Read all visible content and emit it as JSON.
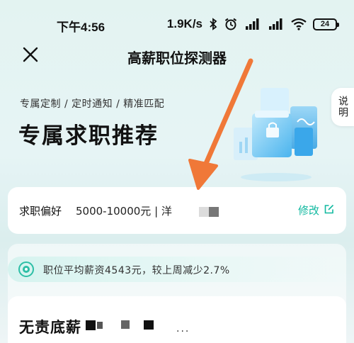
{
  "status_bar": {
    "time": "下午4:56",
    "net_speed": "1.9K/s",
    "battery": "24"
  },
  "nav": {
    "title": "高薪职位探测器"
  },
  "hero": {
    "subtitle": "专属定制 / 定时通知 / 精准匹配",
    "title": "专属求职推荐"
  },
  "side_tab": {
    "label": "说明"
  },
  "preference": {
    "label": "求职偏好",
    "value": "5000-10000元 | 洋",
    "edit_label": "修改"
  },
  "salary_banner": {
    "text": "职位平均薪资4543元，较上周减少2.7%"
  },
  "job_card": {
    "title": "无责底薪",
    "trailing": "..."
  },
  "colors": {
    "accent": "#11b9a0",
    "arrow": "#f07838"
  },
  "icons": [
    "close-icon",
    "bluetooth-icon",
    "alarm-icon",
    "signal-icon",
    "wifi-icon",
    "battery-icon",
    "edit-icon",
    "target-icon"
  ]
}
